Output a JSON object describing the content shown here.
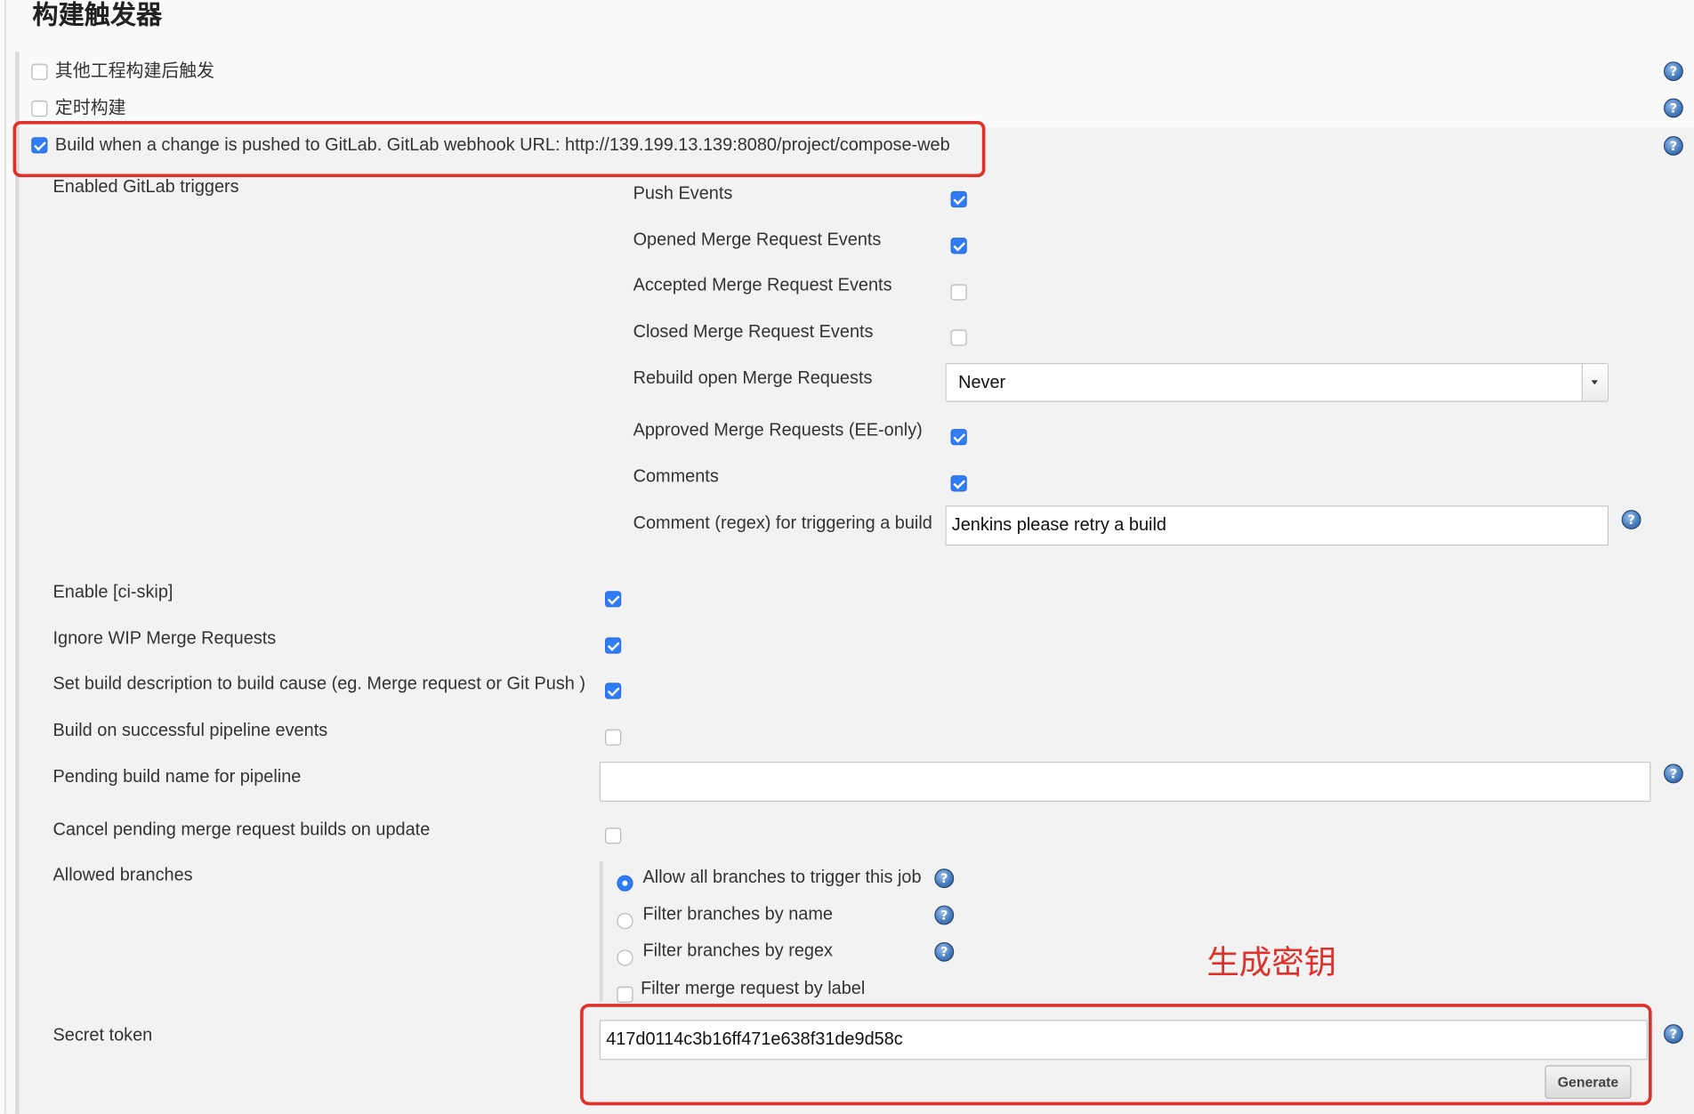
{
  "section": {
    "title": "构建触发器"
  },
  "triggers": [
    {
      "label": "其他工程构建后触发",
      "checked": false
    },
    {
      "label": "定时构建",
      "checked": false
    },
    {
      "label": "Build when a change is pushed to GitLab. GitLab webhook URL: http://139.199.13.139:8080/project/compose-web",
      "checked": true
    }
  ],
  "gitlab": {
    "enabled_triggers": {
      "label": "Enabled GitLab triggers",
      "push_events": {
        "label": "Push Events",
        "checked": true
      },
      "opened_mr_events": {
        "label": "Opened Merge Request Events",
        "checked": true
      },
      "accepted_mr_events": {
        "label": "Accepted Merge Request Events",
        "checked": false
      },
      "closed_mr_events": {
        "label": "Closed Merge Request Events",
        "checked": false
      },
      "rebuild_open_mr": {
        "label": "Rebuild open Merge Requests",
        "value": "Never"
      },
      "approved_mr": {
        "label": "Approved Merge Requests (EE-only)",
        "checked": true
      },
      "comments": {
        "label": "Comments",
        "checked": true
      },
      "comment_regex": {
        "label": "Comment (regex) for triggering a build",
        "value": "Jenkins please retry a build"
      }
    },
    "ci_skip": {
      "label": "Enable [ci-skip]",
      "checked": true
    },
    "ignore_wip": {
      "label": "Ignore WIP Merge Requests",
      "checked": true
    },
    "set_build_description": {
      "label": "Set build description to build cause (eg. Merge request or Git Push )",
      "checked": true
    },
    "pipeline_events": {
      "label": "Build on successful pipeline events",
      "checked": false
    },
    "pending_build_name": {
      "label": "Pending build name for pipeline",
      "value": ""
    },
    "cancel_pending": {
      "label": "Cancel pending merge request builds on update",
      "checked": false
    },
    "allowed_branches": {
      "label": "Allowed branches",
      "options": [
        {
          "label": "Allow all branches to trigger this job",
          "selected": true
        },
        {
          "label": "Filter branches by name",
          "selected": false
        },
        {
          "label": "Filter branches by regex",
          "selected": false
        }
      ],
      "filter_by_label": {
        "label": "Filter merge request by label",
        "checked": false
      }
    },
    "secret_token": {
      "label": "Secret token",
      "value": "417d0114c3b16ff471e638f31de9d58c",
      "generate_label": "Generate"
    }
  },
  "annotation": {
    "text": "生成密钥"
  },
  "colors": {
    "checkbox_checked": "#2f7cf6",
    "annotation_red": "#e0302a",
    "panel_background": "#f2f2f2",
    "help_icon": "#4a7fc0"
  },
  "icons": {
    "help": "help-icon",
    "select_arrow": "chevron-down-icon"
  }
}
